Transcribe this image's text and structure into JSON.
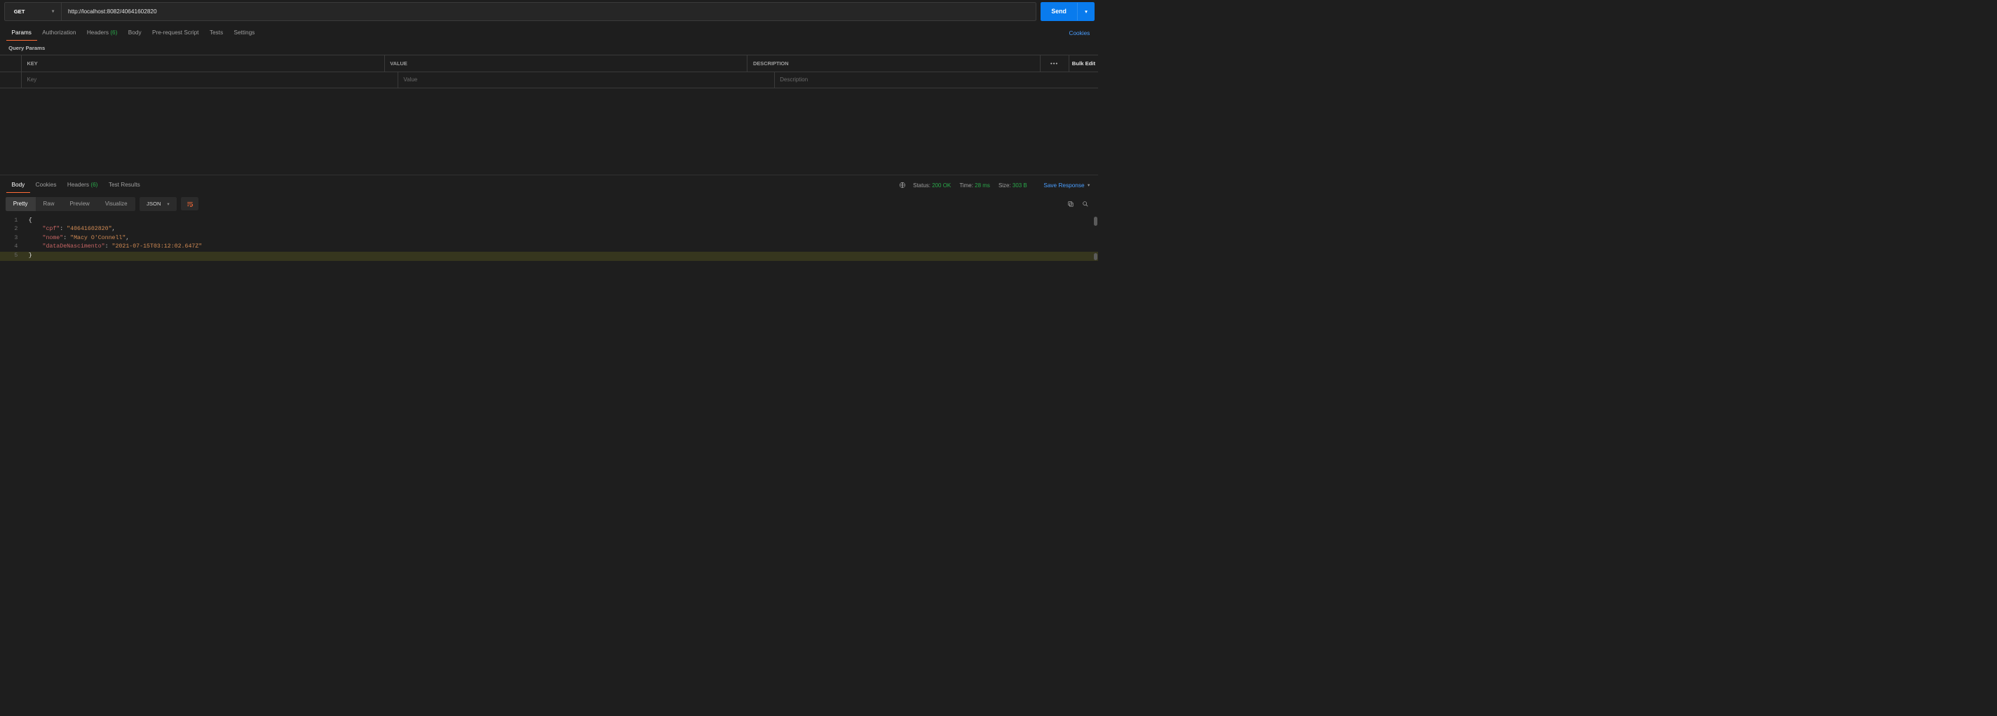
{
  "request": {
    "method": "GET",
    "url": "http://localhost:8082/40641602820",
    "send_label": "Send"
  },
  "tabs": {
    "params": "Params",
    "authorization": "Authorization",
    "headers": "Headers",
    "headers_count": "(6)",
    "body": "Body",
    "prerequest": "Pre-request Script",
    "tests": "Tests",
    "settings": "Settings",
    "cookies_link": "Cookies"
  },
  "params_section": {
    "label": "Query Params",
    "columns": {
      "key": "KEY",
      "value": "VALUE",
      "description": "DESCRIPTION"
    },
    "placeholders": {
      "key": "Key",
      "value": "Value",
      "description": "Description"
    },
    "bulk_edit": "Bulk Edit"
  },
  "response_tabs": {
    "body": "Body",
    "cookies": "Cookies",
    "headers": "Headers",
    "headers_count": "(6)",
    "test_results": "Test Results"
  },
  "status": {
    "status_label": "Status:",
    "status_value": "200 OK",
    "time_label": "Time:",
    "time_value": "28 ms",
    "size_label": "Size:",
    "size_value": "303 B",
    "save_response": "Save Response"
  },
  "view": {
    "pretty": "Pretty",
    "raw": "Raw",
    "preview": "Preview",
    "visualize": "Visualize",
    "format": "JSON"
  },
  "response_body": {
    "lines": [
      "1",
      "2",
      "3",
      "4",
      "5"
    ],
    "l1": "{",
    "k2": "\"cpf\"",
    "v2": "\"40641602820\"",
    "k3": "\"nome\"",
    "v3": "\"Macy O'Connell\"",
    "k4": "\"dataDeNascimento\"",
    "v4": "\"2021-07-15T03:12:02.647Z\"",
    "l5": "}"
  }
}
